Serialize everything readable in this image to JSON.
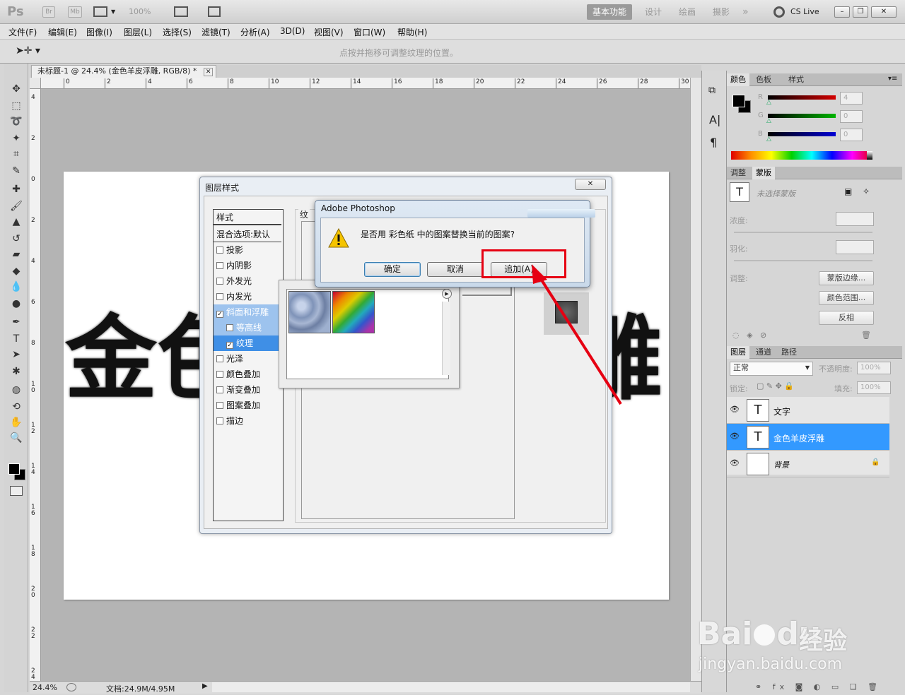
{
  "app": {
    "logo": "Ps",
    "chips": [
      "Br",
      "Mb"
    ],
    "zoom": "100%",
    "workspaces": [
      "基本功能",
      "设计",
      "绘画",
      "摄影"
    ],
    "more": "»",
    "cslive": "CS Live",
    "win_controls": [
      "–",
      "❐",
      "✕"
    ]
  },
  "menu": [
    "文件(F)",
    "编辑(E)",
    "图像(I)",
    "图层(L)",
    "选择(S)",
    "滤镜(T)",
    "分析(A)",
    "3D(D)",
    "视图(V)",
    "窗口(W)",
    "帮助(H)"
  ],
  "options_bar": {
    "hint": "点按并拖移可调整纹理的位置。"
  },
  "document": {
    "tab_title": "未标题-1 @ 24.4% (金色羊皮浮雕, RGB/8) *",
    "ruler_h": [
      "0",
      "2",
      "4",
      "6",
      "8",
      "10",
      "12",
      "14",
      "16",
      "18",
      "20",
      "22",
      "24",
      "26",
      "28",
      "30"
    ],
    "ruler_v": [
      "4",
      "2",
      "0",
      "2",
      "4",
      "6",
      "8",
      "1 0",
      "1 2",
      "1 4",
      "1 6",
      "1 8",
      "2 0",
      "2 2",
      "2 4"
    ],
    "canvas_text_left": "金色",
    "canvas_text_right": "雕",
    "status_zoom": "24.4%",
    "status_doc": "文档:24.9M/4.95M"
  },
  "layer_style": {
    "title": "图层样式",
    "list_header": "样式",
    "blend": "混合选项:默认",
    "items": [
      {
        "label": "投影",
        "checked": false,
        "state": ""
      },
      {
        "label": "内阴影",
        "checked": false,
        "state": ""
      },
      {
        "label": "外发光",
        "checked": false,
        "state": ""
      },
      {
        "label": "内发光",
        "checked": false,
        "state": ""
      },
      {
        "label": "斜面和浮雕",
        "checked": true,
        "state": "hl2"
      },
      {
        "label": "等高线",
        "checked": false,
        "state": "hl2 sub"
      },
      {
        "label": "纹理",
        "checked": true,
        "state": "hl sub"
      },
      {
        "label": "光泽",
        "checked": false,
        "state": ""
      },
      {
        "label": "颜色叠加",
        "checked": false,
        "state": ""
      },
      {
        "label": "渐变叠加",
        "checked": false,
        "state": ""
      },
      {
        "label": "图案叠加",
        "checked": false,
        "state": ""
      },
      {
        "label": "描边",
        "checked": false,
        "state": ""
      }
    ],
    "group_label": "纹"
  },
  "alert": {
    "title": "Adobe Photoshop",
    "message": "是否用 彩色纸 中的图案替换当前的图案?",
    "ok": "确定",
    "cancel": "取消",
    "append": "追加(A)"
  },
  "color_panel": {
    "tabs": [
      "颜色",
      "色板",
      "样式"
    ],
    "channels": [
      {
        "label": "R",
        "value": "4",
        "color": "#d40000"
      },
      {
        "label": "G",
        "value": "0",
        "color": "#00b400"
      },
      {
        "label": "B",
        "value": "0",
        "color": "#0000d4"
      }
    ]
  },
  "masks_panel": {
    "tabs": [
      "调整",
      "蒙版"
    ],
    "status": "未选择蒙版",
    "density": "浓度:",
    "feather": "羽化:",
    "adjust": "调整:",
    "buttons": [
      "蒙版边缘...",
      "颜色范围...",
      "反相"
    ]
  },
  "layers_panel": {
    "tabs": [
      "图层",
      "通道",
      "路径"
    ],
    "blend_mode": "正常",
    "opacity_label": "不透明度:",
    "opacity": "100%",
    "lock_label": "锁定:",
    "fill_label": "填充:",
    "fill": "100%",
    "layers": [
      {
        "name": "文字",
        "thumb": "T",
        "selected": false
      },
      {
        "name": "金色羊皮浮雕",
        "thumb": "T",
        "selected": true
      },
      {
        "name": "背景",
        "thumb": "",
        "selected": false
      }
    ]
  },
  "watermark": {
    "brand": "Bai",
    "brand2": "du",
    "product": "经验",
    "url": "jingyan.baidu.com"
  },
  "colors": {
    "accent": "#3399ff",
    "annotation": "#e60012"
  }
}
